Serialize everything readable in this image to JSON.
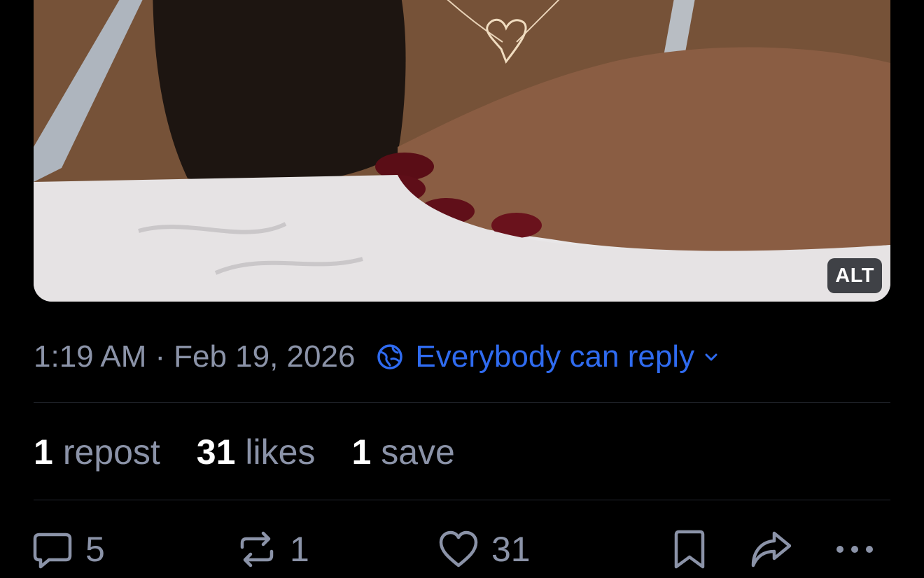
{
  "image": {
    "alt_label": "ALT"
  },
  "meta": {
    "time": "1:19 AM",
    "separator": "·",
    "date": "Feb 19, 2026",
    "reply_setting": "Everybody can reply",
    "reply_color": "#2f6bf0"
  },
  "stats": {
    "reposts": {
      "count": "1",
      "label": "repost"
    },
    "likes": {
      "count": "31",
      "label": "likes"
    },
    "saves": {
      "count": "1",
      "label": "save"
    }
  },
  "actions": {
    "reply_count": "5",
    "repost_count": "1",
    "like_count": "31",
    "icons": [
      "speech-bubble-icon",
      "repost-icon",
      "heart-icon",
      "bookmark-icon",
      "share-icon",
      "more-icon"
    ]
  }
}
